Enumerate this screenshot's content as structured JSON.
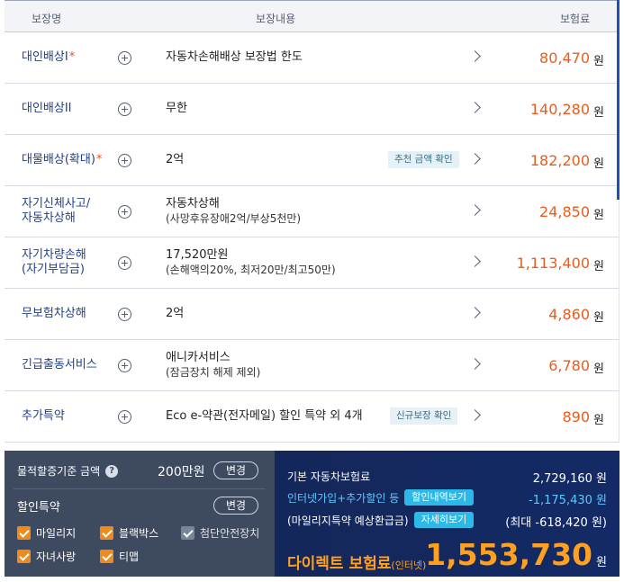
{
  "header": {
    "name": "보장명",
    "content": "보장내용",
    "premium": "보험료"
  },
  "rows": [
    {
      "name": "대인배상I",
      "required": "*",
      "content": "자동차손해배상 보장법 한도",
      "sub": "",
      "badge": "",
      "amount": "80,470",
      "unit": "원"
    },
    {
      "name": "대인배상II",
      "required": "",
      "content": "무한",
      "sub": "",
      "badge": "",
      "amount": "140,280",
      "unit": "원"
    },
    {
      "name": "대물배상(확대)",
      "required": "*",
      "content": "2억",
      "sub": "",
      "badge": "추천 금액 확인",
      "amount": "182,200",
      "unit": "원"
    },
    {
      "name": "자기신체사고/",
      "name2": "자동차상해",
      "required": "",
      "content": "자동차상해",
      "sub": "(사망후유장애2억/부상5천만)",
      "badge": "",
      "amount": "24,850",
      "unit": "원"
    },
    {
      "name": "자기차량손해",
      "name2": "(자기부담금)",
      "required": "",
      "content": "17,520만원",
      "sub": "(손해액의20%, 최저20만/최고50만)",
      "badge": "",
      "amount": "1,113,400",
      "unit": "원"
    },
    {
      "name": "무보험차상해",
      "required": "",
      "content": "2억",
      "sub": "",
      "badge": "",
      "amount": "4,860",
      "unit": "원"
    },
    {
      "name": "긴급출동서비스",
      "required": "",
      "content": "애니카서비스",
      "sub": "(잠금장치 해제 제외)",
      "badge": "",
      "amount": "6,780",
      "unit": "원"
    },
    {
      "name": "추가특약",
      "required": "",
      "content": "Eco e-약관(전자메일) 할인 특약 외 4개",
      "sub": "",
      "badge": "신규보장 확인",
      "amount": "890",
      "unit": "원"
    }
  ],
  "left_panel": {
    "property_label": "물적할증기준 금액",
    "help_icon": "?",
    "property_amount": "200만원",
    "change_label": "변경",
    "discount_title": "할인특약",
    "change_label2": "변경",
    "checkboxes": [
      {
        "label": "마일리지",
        "checked": true
      },
      {
        "label": "블랙박스",
        "checked": true
      },
      {
        "label": "첨단안전장치",
        "checked": false
      },
      {
        "label": "자녀사랑",
        "checked": true
      },
      {
        "label": "티맵",
        "checked": true
      }
    ]
  },
  "right_panel": {
    "base_label": "기본 자동차보험료",
    "base_value": "2,729,160 원",
    "discount_label": "인터넷가입+추가할인 등",
    "discount_pill": "할인내역보기",
    "discount_value": "-1,175,430 원",
    "mileage_label": "(마일리지특약 예상환급금)",
    "mileage_pill": "자세히보기",
    "mileage_value": "(최대 -618,420 원)",
    "final_label": "다이렉트 보험료",
    "final_label_small": "(인터넷)",
    "final_value": "1,553,730",
    "final_unit": "원"
  },
  "colors": {
    "accent_orange": "#e85d1e",
    "navy": "#1f3f8f",
    "panel_dark": "#3d4a60",
    "panel_navy": "#14275a",
    "final_orange": "#ffa020"
  }
}
